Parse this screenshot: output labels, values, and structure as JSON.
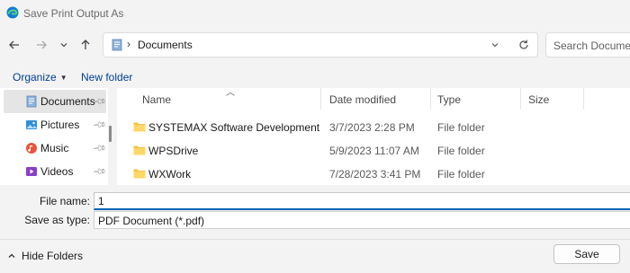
{
  "window": {
    "title": "Save Print Output As",
    "app_icon": "edge-icon"
  },
  "navigation": {
    "back_icon": "arrow-left-icon",
    "forward_icon": "arrow-right-icon",
    "recent_icon": "chevron-down-icon",
    "up_icon": "arrow-up-icon",
    "address": {
      "separator": "›",
      "path": "Documents",
      "dropdown_icon": "chevron-down-icon",
      "refresh_icon": "refresh-icon"
    },
    "search": {
      "placeholder": "Search Documents"
    }
  },
  "commands": {
    "organize_label": "Organize",
    "new_folder_label": "New folder"
  },
  "sidebar": {
    "items": [
      {
        "label": "Documents",
        "icon": "documents-icon",
        "selected": true,
        "pinned": true
      },
      {
        "label": "Pictures",
        "icon": "pictures-icon",
        "selected": false,
        "pinned": true
      },
      {
        "label": "Music",
        "icon": "music-icon",
        "selected": false,
        "pinned": true
      },
      {
        "label": "Videos",
        "icon": "videos-icon",
        "selected": false,
        "pinned": true
      }
    ]
  },
  "files": {
    "columns": [
      "Name",
      "Date modified",
      "Type",
      "Size"
    ],
    "rows": [
      {
        "name": "SYSTEMAX Software Development",
        "date": "3/7/2023 2:28 PM",
        "type": "File folder",
        "size": ""
      },
      {
        "name": "WPSDrive",
        "date": "5/9/2023 11:07 AM",
        "type": "File folder",
        "size": ""
      },
      {
        "name": "WXWork",
        "date": "7/28/2023 3:41 PM",
        "type": "File folder",
        "size": ""
      }
    ]
  },
  "form": {
    "file_name_label": "File name:",
    "file_name_value": "1",
    "save_type_label": "Save as type:",
    "save_type_value": "PDF Document (*.pdf)"
  },
  "footer": {
    "hide_folders_label": "Hide Folders",
    "save_label": "Save"
  },
  "colors": {
    "accent": "#0063b1",
    "folder": "#f5c243",
    "link": "#003e92",
    "selected": "#e5e5e5"
  }
}
